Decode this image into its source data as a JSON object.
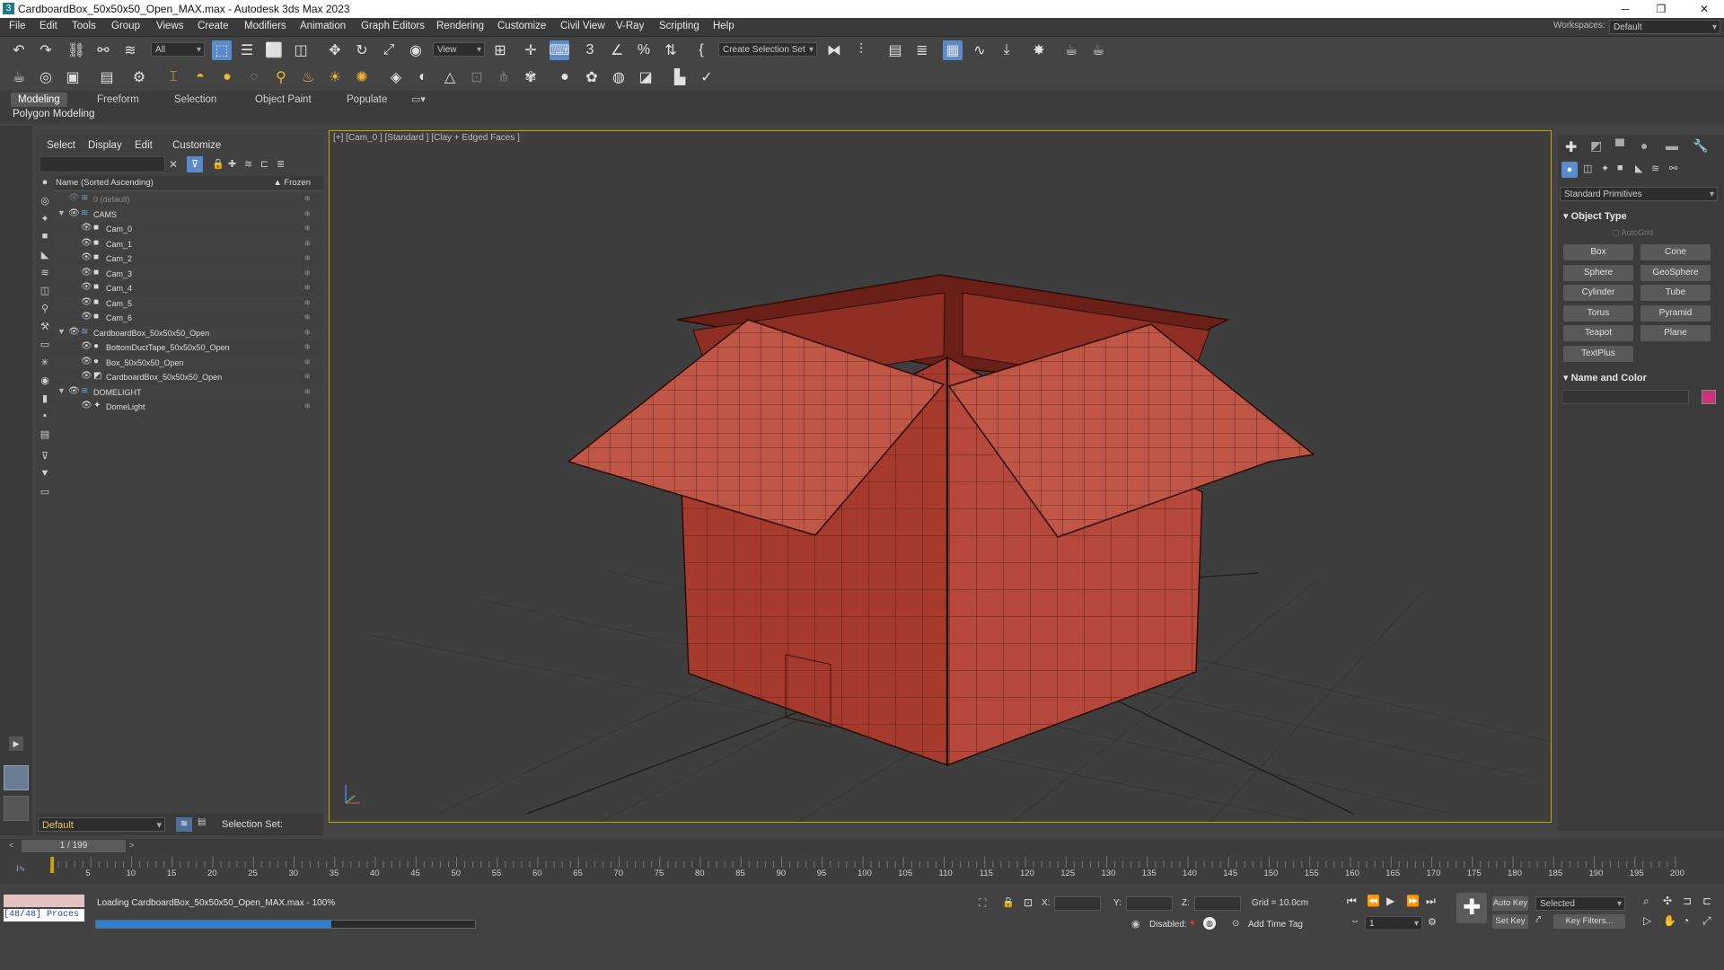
{
  "window": {
    "title": "CardboardBox_50x50x50_Open_MAX.max - Autodesk 3ds Max 2023"
  },
  "menubar": {
    "items": [
      "File",
      "Edit",
      "Tools",
      "Group",
      "Views",
      "Create",
      "Modifiers",
      "Animation",
      "Graph Editors",
      "Rendering",
      "Customize",
      "Civil View",
      "V-Ray",
      "Scripting",
      "Help"
    ],
    "workspaces_label": "Workspaces:",
    "workspaces_value": "Default"
  },
  "toolbar": {
    "filter_value": "All",
    "refcoord_value": "View",
    "selection_set_value": "Create Selection Set"
  },
  "ribbon": {
    "tabs": [
      "Modeling",
      "Freeform",
      "Selection",
      "Object Paint",
      "Populate"
    ],
    "active_tab": "Modeling",
    "panel_label": "Polygon Modeling"
  },
  "explorer": {
    "menu": [
      "Select",
      "Display",
      "Edit",
      "Customize"
    ],
    "column_name": "Name (Sorted Ascending)",
    "column_frozen": "▲ Frozen",
    "rows": [
      {
        "label": "0 (default)",
        "level": 0,
        "type": "layer",
        "dim": true
      },
      {
        "label": "CAMS",
        "level": 0,
        "type": "layer"
      },
      {
        "label": "Cam_0",
        "level": 1,
        "type": "camera"
      },
      {
        "label": "Cam_1",
        "level": 1,
        "type": "camera"
      },
      {
        "label": "Cam_2",
        "level": 1,
        "type": "camera"
      },
      {
        "label": "Cam_3",
        "level": 1,
        "type": "camera"
      },
      {
        "label": "Cam_4",
        "level": 1,
        "type": "camera"
      },
      {
        "label": "Cam_5",
        "level": 1,
        "type": "camera"
      },
      {
        "label": "Cam_6",
        "level": 1,
        "type": "camera"
      },
      {
        "label": "CardboardBox_50x50x50_Open",
        "level": 0,
        "type": "layer"
      },
      {
        "label": "BottomDuctTape_50x50x50_Open",
        "level": 1,
        "type": "mesh"
      },
      {
        "label": "Box_50x50x50_Open",
        "level": 1,
        "type": "mesh"
      },
      {
        "label": "CardboardBox_50x50x50_Open",
        "level": 1,
        "type": "group"
      },
      {
        "label": "DOMELIGHT",
        "level": 0,
        "type": "layer"
      },
      {
        "label": "DomeLight",
        "level": 1,
        "type": "light"
      }
    ]
  },
  "viewport": {
    "label": "[+] [Cam_0 ] [Standard ] [Clay + Edged Faces ]",
    "box_color": "#b5483a"
  },
  "command_panel": {
    "category_value": "Standard Primitives",
    "object_type_title": "Object Type",
    "autogrid_label": "AutoGrid",
    "buttons": [
      "Box",
      "Cone",
      "Sphere",
      "GeoSphere",
      "Cylinder",
      "Tube",
      "Torus",
      "Pyramid",
      "Teapot",
      "Plane",
      "TextPlus"
    ],
    "name_color_title": "Name and Color",
    "swatch_color": "#c8327a"
  },
  "layerbar": {
    "layer_value": "Default",
    "selection_set_label": "Selection Set:"
  },
  "timeslider": {
    "frame_label": "1 / 199"
  },
  "trackbar": {
    "ticks": [
      "5",
      "10",
      "15",
      "20",
      "25",
      "30",
      "35",
      "40",
      "45",
      "50",
      "55",
      "60",
      "65",
      "70",
      "75",
      "80",
      "85",
      "90",
      "95",
      "100",
      "105",
      "110",
      "115",
      "120",
      "125",
      "130",
      "135",
      "140",
      "145",
      "150",
      "155",
      "160",
      "165",
      "170",
      "175",
      "180",
      "185",
      "190",
      "195",
      "200"
    ]
  },
  "status": {
    "maxscript_text": "[48/48] Proces",
    "loading_text": "Loading CardboardBox_50x50x50_Open_MAX.max  -  100%",
    "progress_fraction": 0.62,
    "x_label": "X:",
    "y_label": "Y:",
    "z_label": "Z:",
    "grid_text": "Grid = 10.0cm",
    "disabled_label": "Disabled:",
    "add_time_tag": "Add Time Tag",
    "auto_key": "Auto Key",
    "set_key": "Set Key",
    "selected_value": "Selected",
    "frame_value": "1",
    "key_filters": "Key Filters..."
  }
}
